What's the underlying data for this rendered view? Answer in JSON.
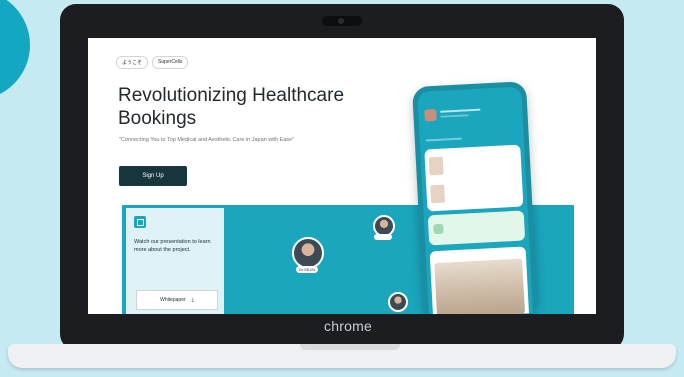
{
  "device": {
    "brand": "chrome"
  },
  "page": {
    "pills": [
      "ようこそ",
      "SuperCells"
    ],
    "title": "Revolutionizing Healthcare Bookings",
    "tagline": "\"Connecting You to Top Medical and Aesthetic Care in Japan with Ease\"",
    "signup_label": "Sign Up",
    "presentation_card": {
      "text": "Watch our presentation to learn more about the project.",
      "whitepaper_label": "Whitepaper"
    },
    "avatar_tags": [
      "Dr.SEIJU"
    ]
  },
  "colors": {
    "accent": "#1aa6bd",
    "dark_button": "#17353d",
    "background": "#c5eaf1"
  }
}
